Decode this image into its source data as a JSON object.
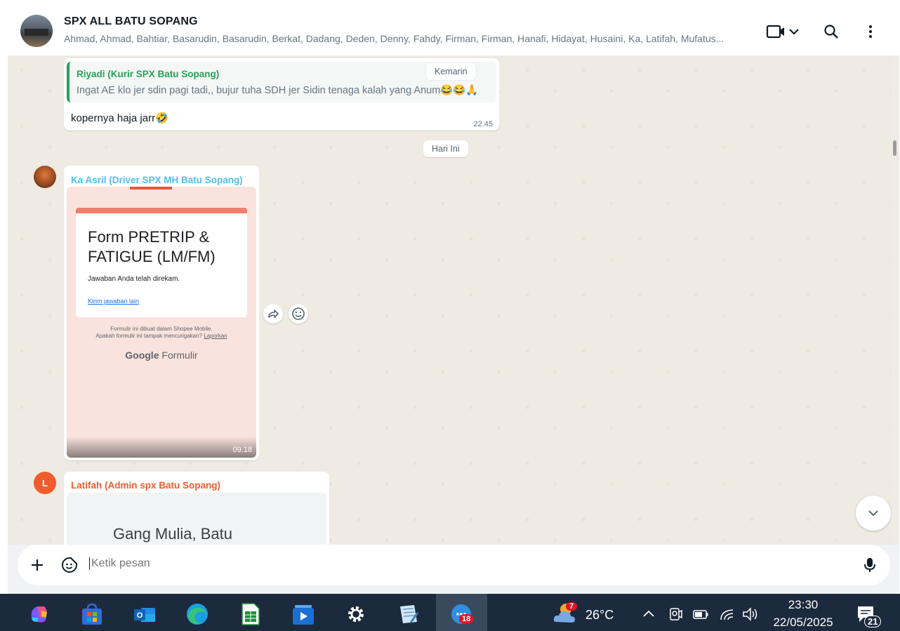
{
  "header": {
    "title": "SPX ALL BATU SOPANG",
    "members": "Ahmad, Ahmad, Bahtiar, Basarudin, Basarudin, Berkat, Dadang, Deden, Denny, Fahdy, Firman, Firman, Hanafi, Hidayat, Husaini, Ka, Latifah, Mufatus..."
  },
  "messages": {
    "reply": {
      "quoted_author": "Riyadi (Kurir SPX Batu Sopang)",
      "quoted_date": "Kemarin",
      "quoted_text": "Ingat AE klo jer sdin pagi tadi,, bujur tuha SDH jer Sidin tenaga kalah yang Anum😂😂🙏",
      "text": "kopernya haja jarr🤣",
      "time": "22.45"
    },
    "date_divider": "Hari Ini",
    "form_msg": {
      "sender": "Ka Asril (Driver SPX MH Batu Sopang)",
      "sender_color": "#53bdeb",
      "form_title": "Form PRETRIP & FATIGUE (LM/FM)",
      "form_sub": "Jawaban Anda telah direkam.",
      "form_link": "Kirim jawaban lain",
      "form_foot_1": "Formulir ini dibuat dalam Shopee Mobile.",
      "form_foot_2": "Apakah formulir ini tampak mencurigakan?",
      "form_foot_link": "Laporkan",
      "brand_google": "Google",
      "brand_formulir": "Formulir",
      "time": "09.18"
    },
    "map_msg": {
      "sender": "Latifah (Admin spx Batu Sopang)",
      "sender_color": "#f15c2d",
      "avatar_letter": "L",
      "preview_text": "Gang Mulia, Batu"
    }
  },
  "composer": {
    "placeholder": "Ketik pesan"
  },
  "taskbar": {
    "weather_temp": "26°C",
    "weather_badge": "7",
    "time": "23:30",
    "date": "22/05/2025",
    "whatsapp_badge": "18",
    "notification_count": "21"
  },
  "colors": {
    "accent_green": "#25a25a",
    "chat_bg": "#efeae2",
    "taskbar_bg": "#1c2a3d"
  }
}
